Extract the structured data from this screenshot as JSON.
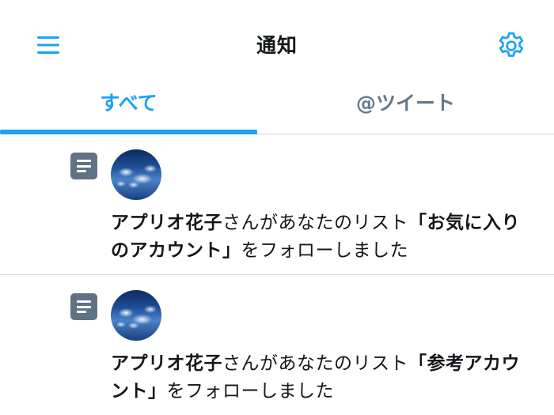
{
  "header": {
    "title": "通知"
  },
  "icons": {
    "menu": "hamburger-menu-icon",
    "settings": "gear-icon",
    "list": "list-icon"
  },
  "colors": {
    "accent": "#1da1f2",
    "inactive_tab": "#657786",
    "list_icon_bg": "#627285"
  },
  "tabs": [
    {
      "label": "すべて",
      "active": true
    },
    {
      "label": "@ツイート",
      "active": false
    }
  ],
  "notifications": [
    {
      "user": "アプリオ花子",
      "text_before": "さんがあなたのリスト",
      "list_open": "「",
      "list_name": "お気に入りのアカウント",
      "list_close": "」",
      "text_after": "をフォローしました"
    },
    {
      "user": "アプリオ花子",
      "text_before": "さんがあなたのリスト",
      "list_open": "「",
      "list_name": "参考アカウント",
      "list_close": "」",
      "text_after": "をフォローしました"
    }
  ]
}
